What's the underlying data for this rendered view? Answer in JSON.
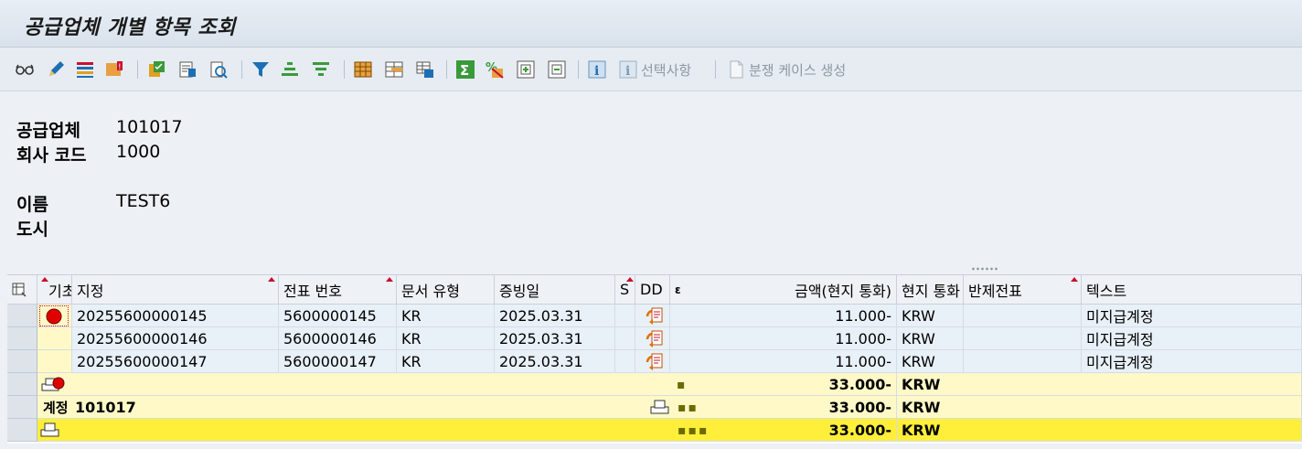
{
  "window": {
    "title": "공급업체 개별 항목 조회"
  },
  "toolbar": {
    "selections_label": "선택사항",
    "dispute_case_label": "분쟁 케이스 생성",
    "icons": [
      "glasses-icon",
      "pencil-icon",
      "select-layout-icon",
      "exception-icon",
      "document-check-icon",
      "document-display-icon",
      "document-search-icon",
      "filter-icon",
      "sort-ascending-icon",
      "sort-descending-icon",
      "layout-grid-icon",
      "insert-column-icon",
      "save-layout-icon",
      "sum-icon",
      "subtotal-icon",
      "expand-icon",
      "collapse-icon",
      "info-icon",
      "info-selections-icon",
      "document-icon"
    ]
  },
  "header": {
    "vendor_label": "공급업체",
    "vendor_value": "101017",
    "company_code_label": "회사 코드",
    "company_code_value": "1000",
    "name_label": "이름",
    "name_value": "TEST6",
    "city_label": "도시",
    "city_value": ""
  },
  "table": {
    "columns": [
      "기초",
      "지정",
      "전표 번호",
      "문서 유형",
      "증빙일",
      "S",
      "DD",
      "ε",
      "금액(현지 통화)",
      "현지 통화",
      "반제전표",
      "텍스트"
    ],
    "rows": [
      {
        "assignment": "20255600000145",
        "doc_no": "5600000145",
        "doc_type": "KR",
        "doc_date": "2025.03.31",
        "amount": "11.000-",
        "currency": "KRW",
        "text": "미지급계정"
      },
      {
        "assignment": "20255600000146",
        "doc_no": "5600000146",
        "doc_type": "KR",
        "doc_date": "2025.03.31",
        "amount": "11.000-",
        "currency": "KRW",
        "text": "미지급계정"
      },
      {
        "assignment": "20255600000147",
        "doc_no": "5600000147",
        "doc_type": "KR",
        "doc_date": "2025.03.31",
        "amount": "11.000-",
        "currency": "KRW",
        "text": "미지급계정"
      }
    ],
    "subtotal1": {
      "dots": "▪",
      "amount": "33.000-",
      "currency": "KRW"
    },
    "subtotal2": {
      "label": "계정",
      "account": "101017",
      "dots": "▪▪",
      "amount": "33.000-",
      "currency": "KRW"
    },
    "total": {
      "dots": "▪▪▪",
      "amount": "33.000-",
      "currency": "KRW"
    }
  },
  "colors": {
    "accent": "#1c6fb5",
    "status_red": "#e00000",
    "subtotal_yellow": "#fff9c8",
    "total_yellow": "#ffef3a"
  }
}
